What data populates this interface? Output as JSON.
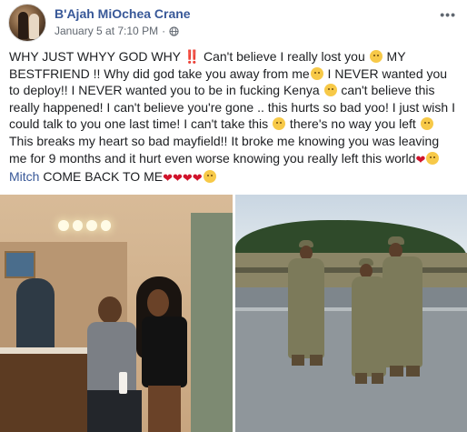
{
  "post": {
    "author": "B'Ajah MiOchea Crane",
    "timestamp": "January 5 at 7:10 PM",
    "separator": "·",
    "more_label": "•••",
    "privacy_icon": "globe-icon",
    "more_icon": "more-options-icon"
  },
  "body": {
    "p1": "WHY JUST WHYY GOD WHY ",
    "p1_bang": "‼️",
    "p2": " Can't believe I really lost you ",
    "p3": " MY BESTFRIEND !! Why did god take you away from me",
    "p4": " I NEVER wanted you to deploy!! I NEVER wanted you to be in fucking Kenya ",
    "p5": " can't believe this really happened! I can't believe you're gone .. this hurts so bad yoo! I just wish I could talk to you one last time! I can't take this ",
    "p6": " there's no way you left ",
    "p7": " This breaks my heart so bad mayfield!! It broke me knowing you was leaving me for 9 months and it hurt even worse knowing you really left this world",
    "mention": "Mitch",
    "p8": " COME BACK TO ME",
    "heart": "❤"
  },
  "photos": {
    "left_label": "bathroom-selfie-photo",
    "right_label": "soldiers-saluting-photo"
  },
  "colors": {
    "link": "#385898",
    "meta": "#606770",
    "text": "#1c1e21",
    "heart": "#d0142c"
  }
}
